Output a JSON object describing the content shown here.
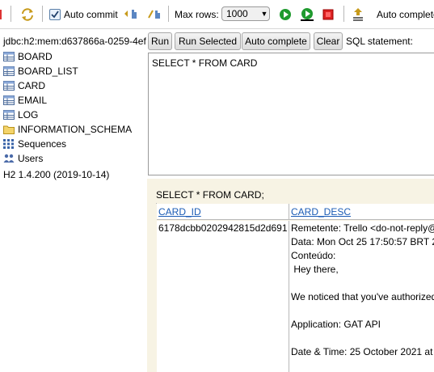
{
  "toolbar": {
    "auto_commit_label": "Auto commit",
    "max_rows_label": "Max rows:",
    "max_rows_value": "1000",
    "auto_complete_label": "Auto complete"
  },
  "tree": {
    "connection": "jdbc:h2:mem:d637866a-0259-4ef",
    "items": [
      "BOARD",
      "BOARD_LIST",
      "CARD",
      "EMAIL",
      "LOG",
      "INFORMATION_SCHEMA",
      "Sequences",
      "Users"
    ],
    "version": "H2 1.4.200 (2019-10-14)"
  },
  "buttons": {
    "run": "Run",
    "run_selected": "Run Selected",
    "auto_complete": "Auto complete",
    "clear": "Clear"
  },
  "sql_label": "SQL statement:",
  "editor_text": "SELECT * FROM CARD",
  "result": {
    "title": "SELECT * FROM CARD;",
    "columns": [
      "CARD_ID",
      "CARD_DESC"
    ],
    "card_id": "6178dcbb0202942815d2d691",
    "card_desc_lines": [
      "Remetente: Trello <do-not-reply@",
      "Data: Mon Oct 25 17:50:57 BRT 2",
      "Conteúdo:",
      " Hey there,",
      "",
      "We noticed that you've authorized",
      "",
      "Application: GAT API",
      "",
      "Date & Time: 25 October 2021 at"
    ]
  }
}
